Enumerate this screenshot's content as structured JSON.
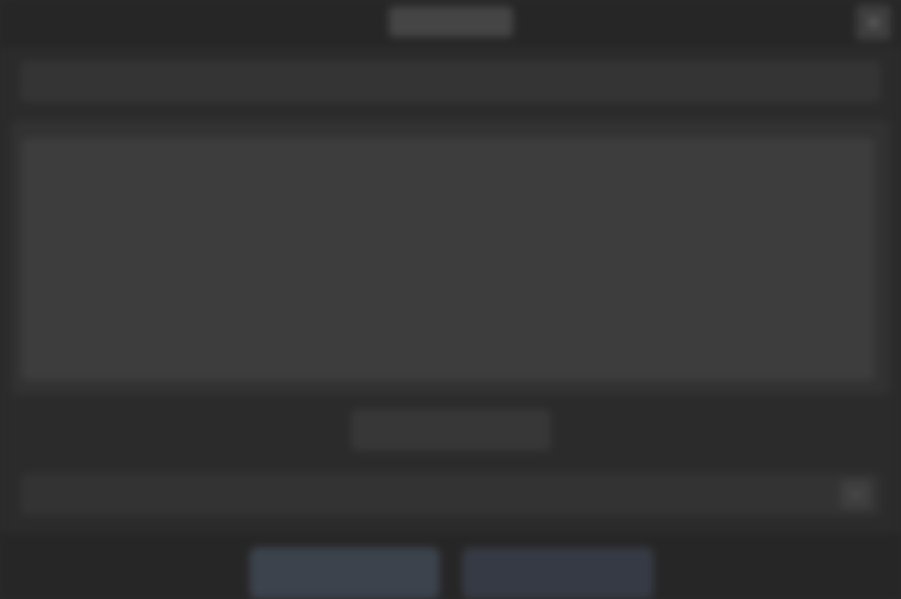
{
  "window": {
    "title": ""
  },
  "fields": {
    "top_label": ""
  },
  "editor": {
    "label": "",
    "content": ""
  },
  "actions": {
    "center_button": ""
  },
  "section": {
    "label": ""
  },
  "footer": {
    "left_button": "",
    "right_button": ""
  },
  "icons": {
    "close": "close-icon",
    "toggle": "chevron-down-icon"
  },
  "colors": {
    "background": "#2b2b2b",
    "accent_button": "#3c434d"
  }
}
